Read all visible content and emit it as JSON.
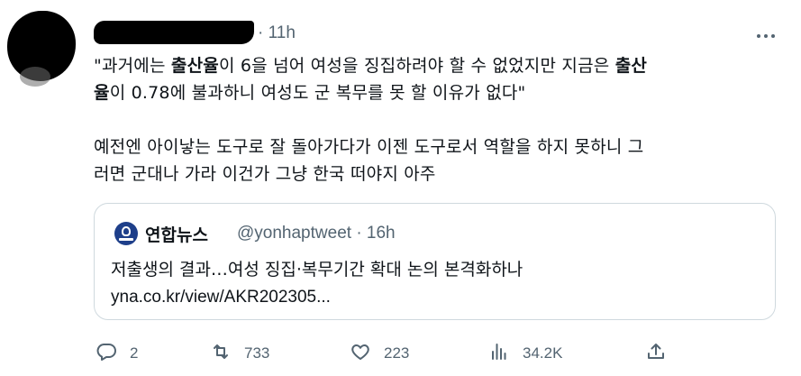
{
  "tweet": {
    "time": "· 11h",
    "lines": [
      {
        "parts": [
          {
            "t": "\"과거에는 ",
            "b": false
          },
          {
            "t": "출산율",
            "b": true
          },
          {
            "t": "이 6을 넘어 여성을 징집하려야 할 수 없었지만 지금은 ",
            "b": false
          },
          {
            "t": "출산",
            "b": true
          }
        ]
      },
      {
        "parts": [
          {
            "t": "율",
            "b": true
          },
          {
            "t": "이 0.78에 불과하니 여성도 군 복무를 못 할 이유가 없다\"",
            "b": false
          }
        ]
      }
    ],
    "para2": [
      "예전엔 아이낳는 도구로 잘 돌아가다가 이젠 도구로서 역할을 하지 못하니 그",
      "러면 군대나 가라 이건가 그냥 한국 떠야지 아주"
    ]
  },
  "quote": {
    "name": "연합뉴스",
    "handle": "@yonhaptweet · 16h",
    "text": "저출생의 결과…여성 징집·복무기간 확대 논의 본격화하나",
    "link": "yna.co.kr/view/AKR202305..."
  },
  "actions": {
    "replies": "2",
    "retweets": "733",
    "likes": "223",
    "views": "34.2K"
  },
  "icons": [
    "more-icon",
    "reply-icon",
    "retweet-icon",
    "like-icon",
    "views-icon",
    "share-icon"
  ]
}
